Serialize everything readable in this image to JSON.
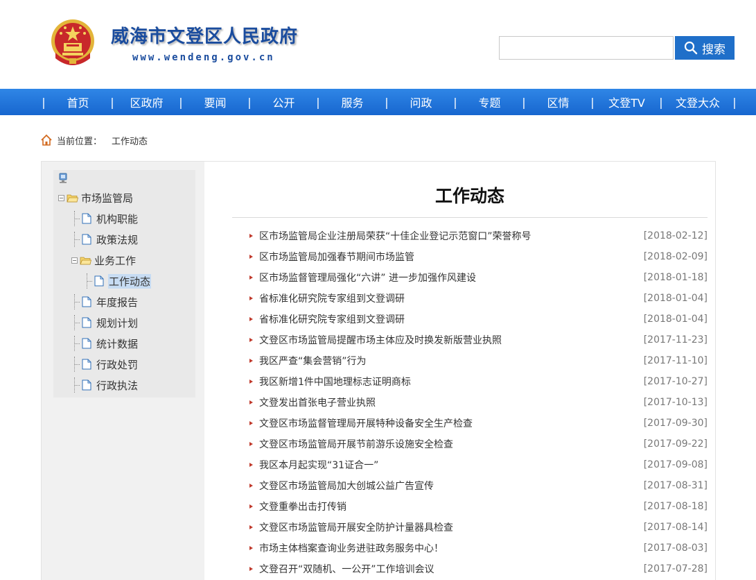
{
  "header": {
    "site_title": "威海市文登区人民政府",
    "site_url": "www.wendeng.gov.cn",
    "search_placeholder": "",
    "search_button": "搜索"
  },
  "nav": {
    "items": [
      "首页",
      "区政府",
      "要闻",
      "公开",
      "服务",
      "问政",
      "专题",
      "区情",
      "文登TV",
      "文登大众"
    ]
  },
  "breadcrumb": {
    "label": "当前位置：",
    "current": "工作动态"
  },
  "sidebar": {
    "root": "市场监管局",
    "items": [
      "机构职能",
      "政策法规",
      "业务工作",
      "工作动态",
      "年度报告",
      "规划计划",
      "统计数据",
      "行政处罚",
      "行政执法"
    ],
    "selected": "工作动态"
  },
  "main": {
    "title": "工作动态",
    "news": [
      {
        "title": "区市场监管局企业注册局荣获“十佳企业登记示范窗口”荣誉称号",
        "date": "[2018-02-12]"
      },
      {
        "title": "区市场监管局加强春节期间市场监管",
        "date": "[2018-02-09]"
      },
      {
        "title": "区市场监督管理局强化“六讲” 进一步加强作风建设",
        "date": "[2018-01-18]"
      },
      {
        "title": "省标准化研究院专家组到文登调研",
        "date": "[2018-01-04]"
      },
      {
        "title": "省标准化研究院专家组到文登调研",
        "date": "[2018-01-04]"
      },
      {
        "title": "文登区市场监管局提醒市场主体应及时换发新版营业执照",
        "date": "[2017-11-23]"
      },
      {
        "title": "我区严查“集会营销”行为",
        "date": "[2017-11-10]"
      },
      {
        "title": "我区新增1件中国地理标志证明商标",
        "date": "[2017-10-27]"
      },
      {
        "title": "文登发出首张电子营业执照",
        "date": "[2017-10-13]"
      },
      {
        "title": "文登区市场监督管理局开展特种设备安全生产检查",
        "date": "[2017-09-30]"
      },
      {
        "title": "文登区市场监管局开展节前游乐设施安全检查",
        "date": "[2017-09-22]"
      },
      {
        "title": "我区本月起实现“31证合一”",
        "date": "[2017-09-08]"
      },
      {
        "title": "文登区市场监管局加大创城公益广告宣传",
        "date": "[2017-08-31]"
      },
      {
        "title": "文登重拳出击打传销",
        "date": "[2017-08-18]"
      },
      {
        "title": "文登区市场监管局开展安全防护计量器具检查",
        "date": "[2017-08-14]"
      },
      {
        "title": "市场主体档案查询业务进驻政务服务中心！",
        "date": "[2017-08-03]"
      },
      {
        "title": "文登召开“双随机、一公开”工作培训会议",
        "date": "[2017-07-28]"
      }
    ]
  },
  "colors": {
    "brand_blue": "#1a4c9e",
    "nav_blue": "#1f74dc",
    "search_blue": "#1f6fc9",
    "accent_red": "#c0392b"
  }
}
